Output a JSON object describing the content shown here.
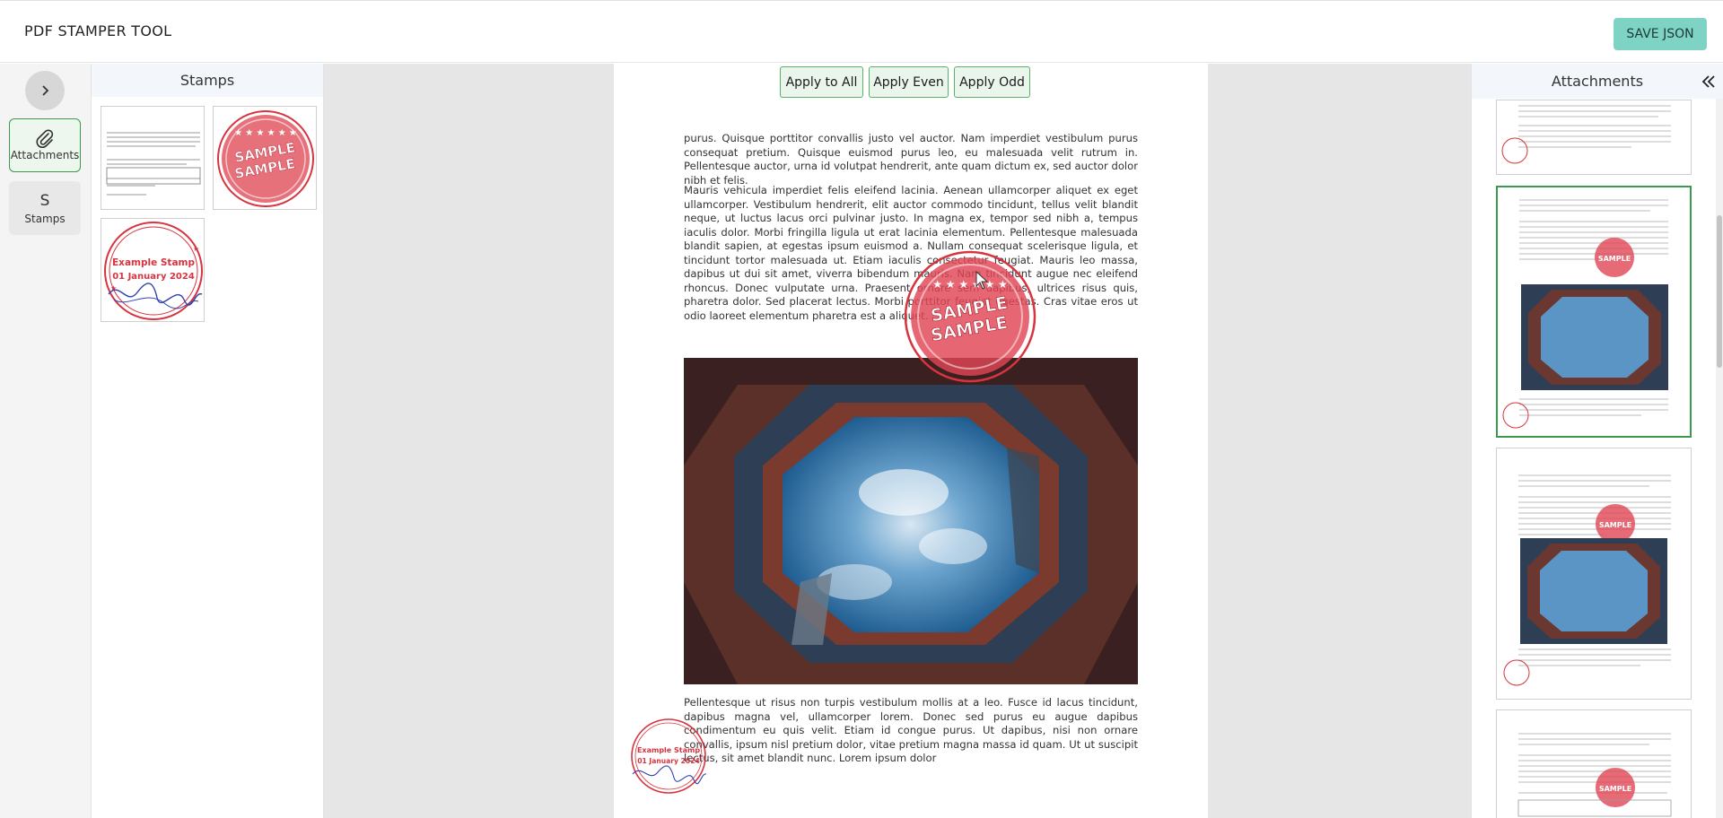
{
  "header": {
    "app_title": "PDF STAMPER TOOL",
    "save_label": "SAVE JSON"
  },
  "icon_bar": {
    "items": [
      {
        "label": "Attachments",
        "icon": "paperclip-icon",
        "glyph": "⚲"
      },
      {
        "label": "Stamps",
        "icon": "letter-s-icon",
        "glyph": "S"
      }
    ]
  },
  "stamps_panel": {
    "title": "Stamps",
    "sample_text": "SAMPLE",
    "example_line1": "Example Stamp",
    "example_line2": "01 January 2024"
  },
  "viewer": {
    "buttons": {
      "apply_all": "Apply to All",
      "apply_even": "Apply Even",
      "apply_odd": "Apply Odd"
    },
    "paragraphs": [
      "purus. Quisque porttitor convallis justo vel auctor. Nam imperdiet vestibulum purus consequat pretium. Quisque euismod purus leo, eu malesuada velit rutrum in. Pellentesque auctor, urna id volutpat hendrerit, ante quam dictum ex, sed auctor dolor nibh et felis.",
      "Mauris vehicula imperdiet felis eleifend lacinia. Aenean ullamcorper aliquet ex eget ullamcorper. Vestibulum hendrerit, elit auctor commodo tincidunt, tellus velit blandit neque, ut luctus lacus orci pulvinar justo. In magna ex, tempor sed nibh a, tempus iaculis dolor. Morbi fringilla ligula ut erat lacinia elementum. Pellentesque malesuada blandit sapien, at egestas ipsum euismod a. Nullam consequat scelerisque ligula, et tincidunt tortor malesuada ut. Etiam iaculis consectetur feugiat. Mauris leo massa, dapibus ut dui sit amet, viverra bibendum mauris. Nam tincidunt augue nec eleifend rhoncus. Donec vulputate urna. Praesent ornare sem dapibus, ultrices risus quis, pharetra dolor. Sed placerat lectus. Morbi porttitor feugiat egestas. Cras vitae eros ut odio laoreet elementum pharetra est a aliquet.",
      "Pellentesque ut risus non turpis vestibulum mollis at a leo. Fusce id lacus tincidunt, dapibus magna vel, ullamcorper lorem. Donec sed purus eu augue dapibus condimentum eu quis velit. Etiam id congue purus. Ut dapibus, nisi non ornare convallis, ipsum nisl pretium dolor, vitae pretium magna massa id quam. Ut ut suscipit lectus, sit amet blandit nunc. Lorem ipsum dolor"
    ],
    "stamp_sample_text": "SAMPLE",
    "stamp_example_line1": "Example Stamp",
    "stamp_example_line2": "01 January 2024"
  },
  "attachments_panel": {
    "title": "Attachments",
    "sample_text": "SAMPLE"
  },
  "colors": {
    "accent_green": "#3a9a4d",
    "save_teal": "#7fd3c5",
    "stamp_red": "#d8343f"
  }
}
